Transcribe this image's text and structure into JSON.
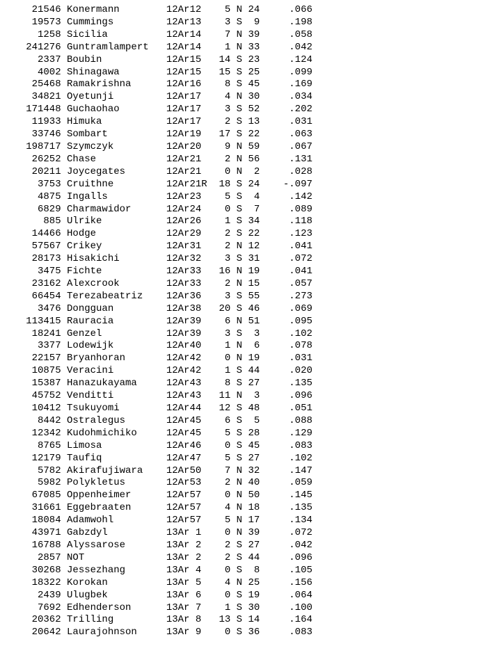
{
  "columns": [
    "id",
    "name",
    "pos",
    "col4",
    "dir",
    "col6",
    "col7"
  ],
  "rows": [
    {
      "id": "21546",
      "name": "Konermann",
      "pos": "12Ar12",
      "col4": "5",
      "dir": "N",
      "col6": "24",
      "col7": ".066"
    },
    {
      "id": "19573",
      "name": "Cummings",
      "pos": "12Ar13",
      "col4": "3",
      "dir": "S",
      "col6": "9",
      "col7": ".198"
    },
    {
      "id": "1258",
      "name": "Sicilia",
      "pos": "12Ar14",
      "col4": "7",
      "dir": "N",
      "col6": "39",
      "col7": ".058"
    },
    {
      "id": "241276",
      "name": "Guntramlampert",
      "pos": "12Ar14",
      "col4": "1",
      "dir": "N",
      "col6": "33",
      "col7": ".042"
    },
    {
      "id": "2337",
      "name": "Boubin",
      "pos": "12Ar15",
      "col4": "14",
      "dir": "S",
      "col6": "23",
      "col7": ".124"
    },
    {
      "id": "4002",
      "name": "Shinagawa",
      "pos": "12Ar15",
      "col4": "15",
      "dir": "S",
      "col6": "25",
      "col7": ".099"
    },
    {
      "id": "25468",
      "name": "Ramakrishna",
      "pos": "12Ar16",
      "col4": "8",
      "dir": "S",
      "col6": "45",
      "col7": ".169"
    },
    {
      "id": "34821",
      "name": "Oyetunji",
      "pos": "12Ar17",
      "col4": "4",
      "dir": "N",
      "col6": "30",
      "col7": ".034"
    },
    {
      "id": "171448",
      "name": "Guchaohao",
      "pos": "12Ar17",
      "col4": "3",
      "dir": "S",
      "col6": "52",
      "col7": ".202"
    },
    {
      "id": "11933",
      "name": "Himuka",
      "pos": "12Ar17",
      "col4": "2",
      "dir": "S",
      "col6": "13",
      "col7": ".031"
    },
    {
      "id": "33746",
      "name": "Sombart",
      "pos": "12Ar19",
      "col4": "17",
      "dir": "S",
      "col6": "22",
      "col7": ".063"
    },
    {
      "id": "198717",
      "name": "Szymczyk",
      "pos": "12Ar20",
      "col4": "9",
      "dir": "N",
      "col6": "59",
      "col7": ".067"
    },
    {
      "id": "26252",
      "name": "Chase",
      "pos": "12Ar21",
      "col4": "2",
      "dir": "N",
      "col6": "56",
      "col7": ".131"
    },
    {
      "id": "20211",
      "name": "Joycegates",
      "pos": "12Ar21",
      "col4": "0",
      "dir": "N",
      "col6": "2",
      "col7": ".028"
    },
    {
      "id": "3753",
      "name": "Cruithne",
      "pos": "12Ar21R",
      "col4": "18",
      "dir": "S",
      "col6": "24",
      "col7": "-.097"
    },
    {
      "id": "4875",
      "name": "Ingalls",
      "pos": "12Ar23",
      "col4": "5",
      "dir": "S",
      "col6": "4",
      "col7": ".142"
    },
    {
      "id": "6829",
      "name": "Charmawidor",
      "pos": "12Ar24",
      "col4": "0",
      "dir": "S",
      "col6": "7",
      "col7": ".089"
    },
    {
      "id": "885",
      "name": "Ulrike",
      "pos": "12Ar26",
      "col4": "1",
      "dir": "S",
      "col6": "34",
      "col7": ".118"
    },
    {
      "id": "14466",
      "name": "Hodge",
      "pos": "12Ar29",
      "col4": "2",
      "dir": "S",
      "col6": "22",
      "col7": ".123"
    },
    {
      "id": "57567",
      "name": "Crikey",
      "pos": "12Ar31",
      "col4": "2",
      "dir": "N",
      "col6": "12",
      "col7": ".041"
    },
    {
      "id": "28173",
      "name": "Hisakichi",
      "pos": "12Ar32",
      "col4": "3",
      "dir": "S",
      "col6": "31",
      "col7": ".072"
    },
    {
      "id": "3475",
      "name": "Fichte",
      "pos": "12Ar33",
      "col4": "16",
      "dir": "N",
      "col6": "19",
      "col7": ".041"
    },
    {
      "id": "23162",
      "name": "Alexcrook",
      "pos": "12Ar33",
      "col4": "2",
      "dir": "N",
      "col6": "15",
      "col7": ".057"
    },
    {
      "id": "66454",
      "name": "Terezabeatriz",
      "pos": "12Ar36",
      "col4": "3",
      "dir": "S",
      "col6": "55",
      "col7": ".273"
    },
    {
      "id": "3476",
      "name": "Dongguan",
      "pos": "12Ar38",
      "col4": "20",
      "dir": "S",
      "col6": "46",
      "col7": ".069"
    },
    {
      "id": "113415",
      "name": "Rauracia",
      "pos": "12Ar39",
      "col4": "6",
      "dir": "N",
      "col6": "51",
      "col7": ".095"
    },
    {
      "id": "18241",
      "name": "Genzel",
      "pos": "12Ar39",
      "col4": "3",
      "dir": "S",
      "col6": "3",
      "col7": ".102"
    },
    {
      "id": "3377",
      "name": "Lodewijk",
      "pos": "12Ar40",
      "col4": "1",
      "dir": "N",
      "col6": "6",
      "col7": ".078"
    },
    {
      "id": "22157",
      "name": "Bryanhoran",
      "pos": "12Ar42",
      "col4": "0",
      "dir": "N",
      "col6": "19",
      "col7": ".031"
    },
    {
      "id": "10875",
      "name": "Veracini",
      "pos": "12Ar42",
      "col4": "1",
      "dir": "S",
      "col6": "44",
      "col7": ".020"
    },
    {
      "id": "15387",
      "name": "Hanazukayama",
      "pos": "12Ar43",
      "col4": "8",
      "dir": "S",
      "col6": "27",
      "col7": ".135"
    },
    {
      "id": "45752",
      "name": "Venditti",
      "pos": "12Ar43",
      "col4": "11",
      "dir": "N",
      "col6": "3",
      "col7": ".096"
    },
    {
      "id": "10412",
      "name": "Tsukuyomi",
      "pos": "12Ar44",
      "col4": "12",
      "dir": "S",
      "col6": "48",
      "col7": ".051"
    },
    {
      "id": "8442",
      "name": "Ostralegus",
      "pos": "12Ar45",
      "col4": "6",
      "dir": "S",
      "col6": "5",
      "col7": ".088"
    },
    {
      "id": "12342",
      "name": "Kudohmichiko",
      "pos": "12Ar45",
      "col4": "5",
      "dir": "S",
      "col6": "28",
      "col7": ".129"
    },
    {
      "id": "8765",
      "name": "Limosa",
      "pos": "12Ar46",
      "col4": "0",
      "dir": "S",
      "col6": "45",
      "col7": ".083"
    },
    {
      "id": "12179",
      "name": "Taufiq",
      "pos": "12Ar47",
      "col4": "5",
      "dir": "S",
      "col6": "27",
      "col7": ".102"
    },
    {
      "id": "5782",
      "name": "Akirafujiwara",
      "pos": "12Ar50",
      "col4": "7",
      "dir": "N",
      "col6": "32",
      "col7": ".147"
    },
    {
      "id": "5982",
      "name": "Polykletus",
      "pos": "12Ar53",
      "col4": "2",
      "dir": "N",
      "col6": "40",
      "col7": ".059"
    },
    {
      "id": "67085",
      "name": "Oppenheimer",
      "pos": "12Ar57",
      "col4": "0",
      "dir": "N",
      "col6": "50",
      "col7": ".145"
    },
    {
      "id": "31661",
      "name": "Eggebraaten",
      "pos": "12Ar57",
      "col4": "4",
      "dir": "N",
      "col6": "18",
      "col7": ".135"
    },
    {
      "id": "18084",
      "name": "Adamwohl",
      "pos": "12Ar57",
      "col4": "5",
      "dir": "N",
      "col6": "17",
      "col7": ".134"
    },
    {
      "id": "43971",
      "name": "Gabzdyl",
      "pos": "13Ar 1",
      "col4": "0",
      "dir": "N",
      "col6": "39",
      "col7": ".072"
    },
    {
      "id": "16788",
      "name": "Alyssarose",
      "pos": "13Ar 2",
      "col4": "2",
      "dir": "S",
      "col6": "27",
      "col7": ".042"
    },
    {
      "id": "2857",
      "name": "NOT",
      "pos": "13Ar 2",
      "col4": "2",
      "dir": "S",
      "col6": "44",
      "col7": ".096"
    },
    {
      "id": "30268",
      "name": "Jessezhang",
      "pos": "13Ar 4",
      "col4": "0",
      "dir": "S",
      "col6": "8",
      "col7": ".105"
    },
    {
      "id": "18322",
      "name": "Korokan",
      "pos": "13Ar 5",
      "col4": "4",
      "dir": "N",
      "col6": "25",
      "col7": ".156"
    },
    {
      "id": "2439",
      "name": "Ulugbek",
      "pos": "13Ar 6",
      "col4": "0",
      "dir": "S",
      "col6": "19",
      "col7": ".064"
    },
    {
      "id": "7692",
      "name": "Edhenderson",
      "pos": "13Ar 7",
      "col4": "1",
      "dir": "S",
      "col6": "30",
      "col7": ".100"
    },
    {
      "id": "20362",
      "name": "Trilling",
      "pos": "13Ar 8",
      "col4": "13",
      "dir": "S",
      "col6": "14",
      "col7": ".164"
    },
    {
      "id": "20642",
      "name": "Laurajohnson",
      "pos": "13Ar 9",
      "col4": "0",
      "dir": "S",
      "col6": "36",
      "col7": ".083"
    }
  ]
}
